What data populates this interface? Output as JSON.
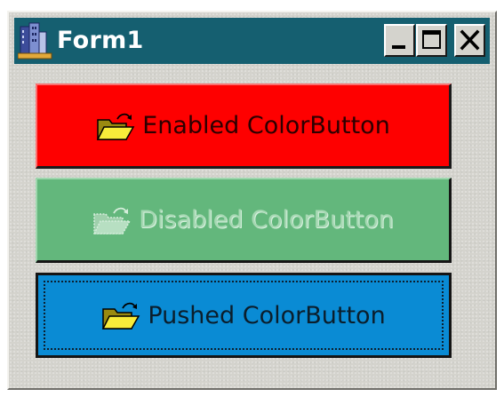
{
  "window": {
    "title": "Form1",
    "app_icon": "form-app-icon",
    "controls": {
      "minimize": "minimize-icon",
      "maximize": "maximize-icon",
      "close": "close-icon"
    },
    "title_bar_color": "#155f70",
    "face_color": "#d4d3cd"
  },
  "buttons": [
    {
      "label": "Enabled ColorButton",
      "icon": "open-folder-icon",
      "state": "enabled",
      "color": "#fe0000"
    },
    {
      "label": "Disabled ColorButton",
      "icon": "open-folder-icon",
      "state": "disabled",
      "color": "#63b77c"
    },
    {
      "label": "Pushed ColorButton",
      "icon": "open-folder-icon",
      "state": "pushed",
      "color": "#0a8bd4"
    }
  ]
}
